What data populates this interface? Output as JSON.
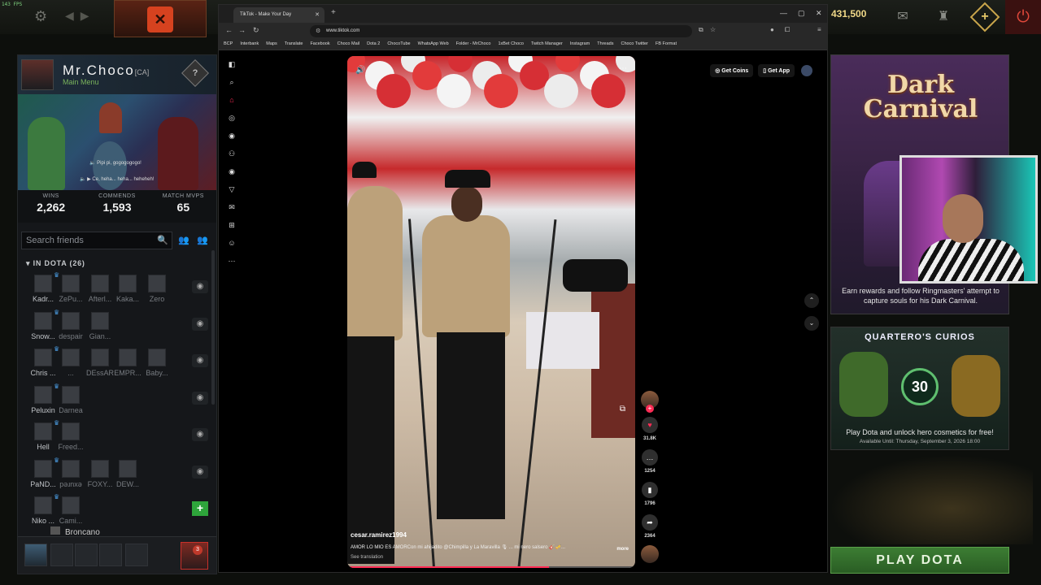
{
  "dota": {
    "fps": "143 FPS",
    "shards": "431,500",
    "profile": {
      "name": "Mr.Choco",
      "tag": "[CA]",
      "menu": "Main Menu",
      "voice_lines": [
        "Pipi pi, gogogogogo!",
        "Ce, heha... heha... heheheh!"
      ],
      "stats": [
        {
          "label": "WINS",
          "value": "2,262"
        },
        {
          "label": "COMMENDS",
          "value": "1,593"
        },
        {
          "label": "MATCH MVPS",
          "value": "65"
        }
      ]
    },
    "search_placeholder": "Search friends",
    "in_dota_section": "IN DOTA (26)",
    "friend_rows": [
      {
        "names": [
          "Kadr...",
          "ZePu...",
          "Afterl...",
          "Kaka...",
          "Zero"
        ],
        "dim": [
          false,
          true,
          true,
          true,
          true
        ],
        "action": "eye"
      },
      {
        "names": [
          "Snow...",
          "despair",
          "Gian...",
          "",
          ""
        ],
        "dim": [
          false,
          true,
          true,
          false,
          false
        ],
        "action": "eye"
      },
      {
        "names": [
          "Chris ...",
          "...",
          "DEssAR",
          "EMPR...",
          "Baby..."
        ],
        "dim": [
          false,
          true,
          true,
          true,
          true
        ],
        "action": "eye"
      },
      {
        "names": [
          "Peluxin",
          "Darnea",
          "",
          "",
          ""
        ],
        "dim": [
          false,
          true,
          false,
          false,
          false
        ],
        "action": "eye"
      },
      {
        "names": [
          "Hell",
          "Freed...",
          "",
          "",
          ""
        ],
        "dim": [
          false,
          true,
          false,
          false,
          false
        ],
        "action": "eye"
      },
      {
        "names": [
          "PaND...",
          "pǝɹnxǝ",
          "FOXY...",
          "DEW...",
          ""
        ],
        "dim": [
          false,
          true,
          true,
          true,
          false
        ],
        "action": "eye"
      },
      {
        "names": [
          "Niko ...",
          "Cami...",
          "",
          "",
          ""
        ],
        "dim": [
          false,
          true,
          false,
          false,
          false
        ],
        "action": "add"
      }
    ],
    "last_friend": "Broncano",
    "party_notifications": "3",
    "event": {
      "title": "Dark Carnival",
      "text": "Earn rewards and follow Ringmasters' attempt to capture souls for his Dark Carnival."
    },
    "curios": {
      "title": "QUARTERO'S CURIOS",
      "count": "30",
      "desc": "Play Dota and unlock hero cosmetics for free!",
      "available": "Available Until: Thursday, September 3, 2026 18:00"
    },
    "play_button": "PLAY DOTA"
  },
  "browser": {
    "tab_title": "TikTok - Make Your Day",
    "url": "www.tiktok.com",
    "bookmarks": [
      "BCP",
      "Interbank",
      "Maps",
      "Translate",
      "Facebook",
      "Choco Mail",
      "Dota 2",
      "ChocoTube",
      "WhatsApp Web",
      "Folder - MrChoco",
      "1xBet Choco",
      "Twitch Manager",
      "Instagram",
      "Threads",
      "Choco Twitter",
      "FB Format"
    ]
  },
  "tiktok": {
    "get_coins": "Get Coins",
    "get_app": "Get App",
    "author": "cesar.ramirez1994",
    "caption": "AMOR LO MÍO ES AMORCon mi ahijadito @Chimpilla y La Maravilla 🎙 ... mi nero salsero 🎸🎺...",
    "more": "more",
    "see_translation": "See translation",
    "likes": "31.8K",
    "comments": "1254",
    "saves": "1796",
    "shares": "2364",
    "progress": 0.7
  },
  "colors": {
    "tiktok_accent": "#fe2c55",
    "play_button": "#3c7d33",
    "shards": "#f0d988"
  }
}
